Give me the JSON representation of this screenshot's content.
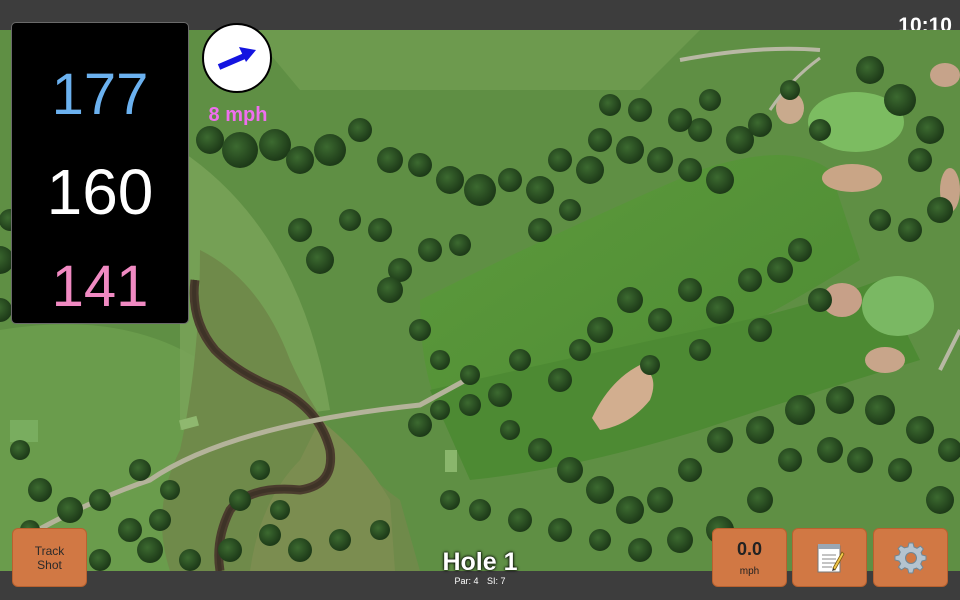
{
  "status_bar": {
    "time": "10:10"
  },
  "distances": {
    "back": "177",
    "middle": "160",
    "front": "141"
  },
  "wind": {
    "speed": "8 mph",
    "arrow_icon": "wind-arrow-icon",
    "arrow_color": "#1414e0"
  },
  "hole": {
    "title": "Hole 1",
    "par": "Par: 4",
    "stroke_index": "SI: 7"
  },
  "buttons": {
    "track_shot_line1": "Track",
    "track_shot_line2": "Shot",
    "speed_value": "0.0",
    "speed_unit": "mph",
    "notes_icon": "notepad-icon",
    "settings_icon": "gear-icon"
  },
  "colors": {
    "back_distance": "#6bb1ef",
    "middle_distance": "#ffffff",
    "front_distance": "#f08ac2",
    "wind_speed": "#ef6eef",
    "button_bg": "#d17844"
  }
}
